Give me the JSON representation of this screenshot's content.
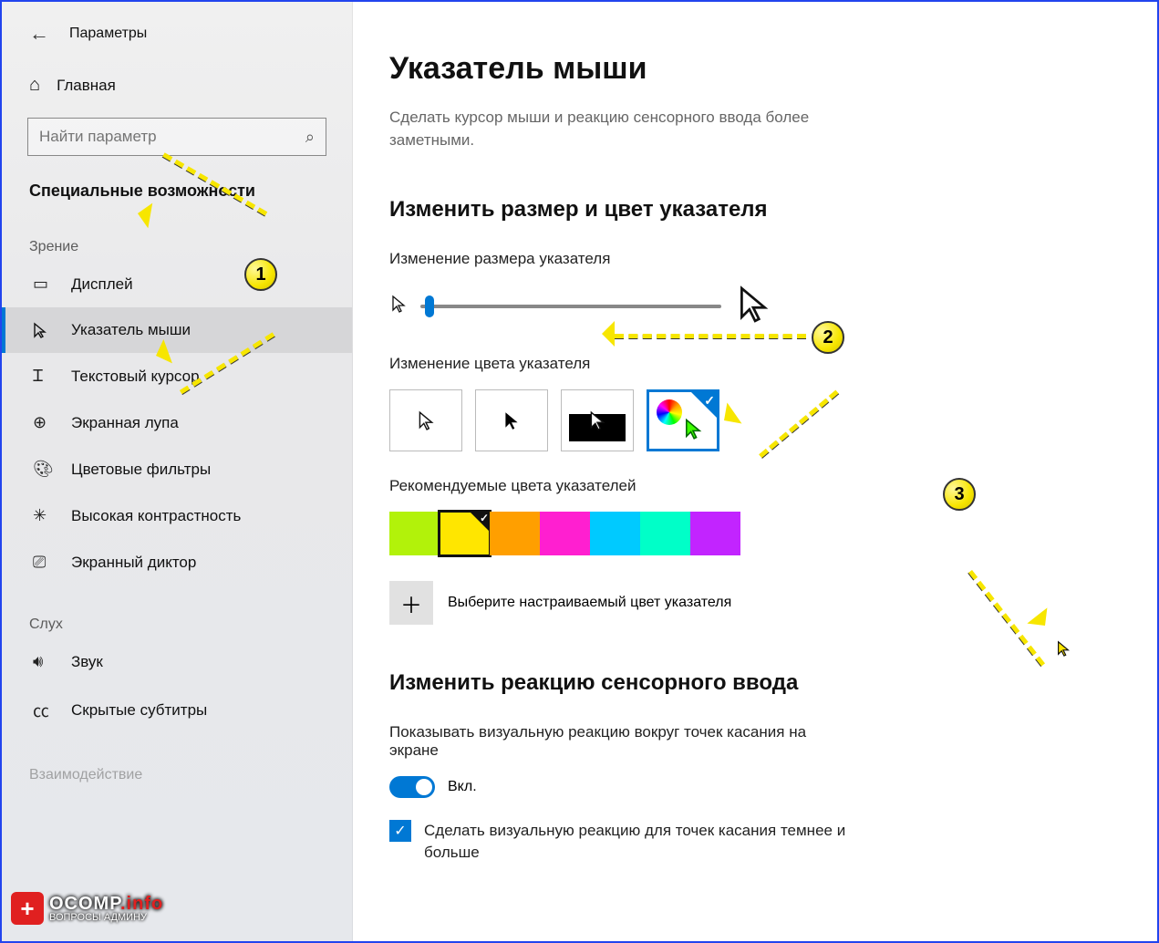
{
  "header": {
    "app_title": "Параметры"
  },
  "sidebar": {
    "home_label": "Главная",
    "search_placeholder": "Найти параметр",
    "section_title": "Специальные возможности",
    "categories": [
      {
        "label": "Зрение",
        "items": [
          {
            "icon": "display",
            "label": "Дисплей"
          },
          {
            "icon": "pointer",
            "label": "Указатель мыши",
            "active": true
          },
          {
            "icon": "text-cursor",
            "label": "Текстовый курсор"
          },
          {
            "icon": "magnifier",
            "label": "Экранная лупа"
          },
          {
            "icon": "palette",
            "label": "Цветовые фильтры"
          },
          {
            "icon": "contrast",
            "label": "Высокая контрастность"
          },
          {
            "icon": "narrator",
            "label": "Экранный диктор"
          }
        ]
      },
      {
        "label": "Слух",
        "items": [
          {
            "icon": "sound",
            "label": "Звук"
          },
          {
            "icon": "cc",
            "label": "Скрытые субтитры"
          }
        ]
      }
    ],
    "last_category_label": "Взаимодействие"
  },
  "main": {
    "title": "Указатель мыши",
    "description": "Сделать курсор мыши и реакцию сенсорного ввода более заметными.",
    "section1_title": "Изменить размер и цвет указателя",
    "size_label": "Изменение размера указателя",
    "color_label": "Изменение цвета указателя",
    "recommended_label": "Рекомендуемые цвета указателей",
    "swatches": [
      {
        "hex": "#b2f20a"
      },
      {
        "hex": "#ffe600",
        "selected": true
      },
      {
        "hex": "#ff9f00"
      },
      {
        "hex": "#ff1fd0"
      },
      {
        "hex": "#00caff"
      },
      {
        "hex": "#00ffc8"
      },
      {
        "hex": "#c224ff"
      }
    ],
    "custom_color_label": "Выберите настраиваемый цвет указателя",
    "section2_title": "Изменить реакцию сенсорного ввода",
    "touch_label": "Показывать визуальную реакцию вокруг точек касания на экране",
    "toggle_state": "Вкл.",
    "checkbox_label": "Сделать визуальную реакцию для точек касания темнее и больше"
  },
  "annotations": {
    "markers": [
      "1",
      "2",
      "3"
    ]
  },
  "watermark": {
    "brand": "OCOMP",
    "suffix": ".info",
    "tagline": "ВОПРОСЫ АДМИНУ"
  }
}
